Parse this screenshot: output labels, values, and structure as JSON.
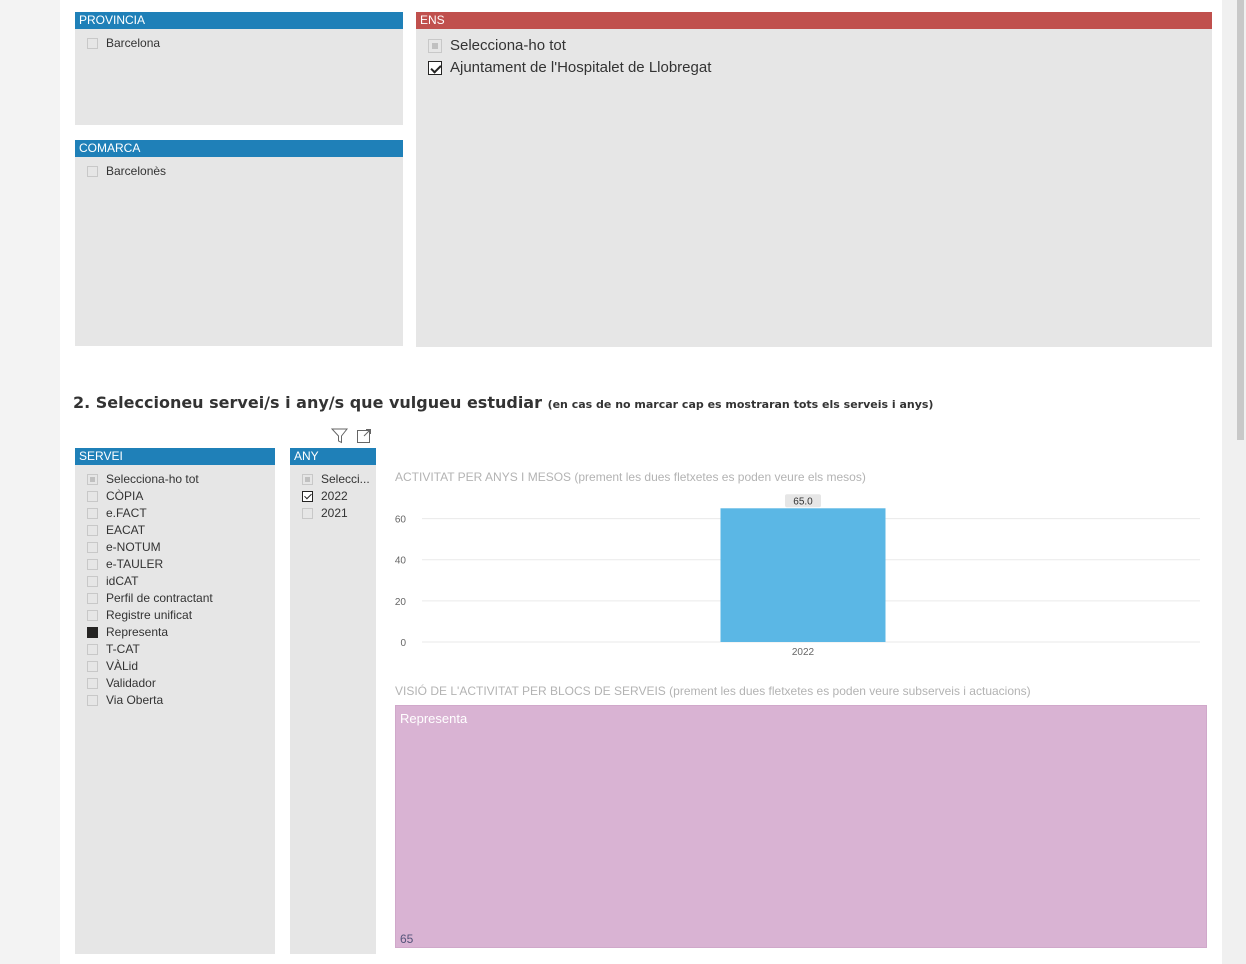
{
  "provincia": {
    "header": "PROVINCIA",
    "items": [
      {
        "label": "Barcelona",
        "state": "unchecked"
      }
    ]
  },
  "comarca": {
    "header": "COMARCA",
    "items": [
      {
        "label": "Barcelonès",
        "state": "unchecked"
      }
    ]
  },
  "ens": {
    "header": "ENS",
    "items": [
      {
        "label": "Selecciona-ho tot",
        "state": "partial"
      },
      {
        "label": "Ajuntament de l'Hospitalet de Llobregat",
        "state": "checked"
      }
    ]
  },
  "section": {
    "title": "2. Seleccioneu servei/s i any/s que vulgueu estudiar",
    "subtitle": "(en cas de no marcar cap es mostraran tots els serveis i anys)"
  },
  "servei": {
    "header": "SERVEI",
    "items": [
      {
        "label": "Selecciona-ho tot",
        "state": "partial"
      },
      {
        "label": "CÒPIA",
        "state": "unchecked"
      },
      {
        "label": "e.FACT",
        "state": "unchecked"
      },
      {
        "label": "EACAT",
        "state": "unchecked"
      },
      {
        "label": "e-NOTUM",
        "state": "unchecked"
      },
      {
        "label": "e-TAULER",
        "state": "unchecked"
      },
      {
        "label": "idCAT",
        "state": "unchecked"
      },
      {
        "label": "Perfil de contractant",
        "state": "unchecked"
      },
      {
        "label": "Registre unificat",
        "state": "unchecked"
      },
      {
        "label": "Representa",
        "state": "filled"
      },
      {
        "label": "T-CAT",
        "state": "unchecked"
      },
      {
        "label": "VÀLid",
        "state": "unchecked"
      },
      {
        "label": "Validador",
        "state": "unchecked"
      },
      {
        "label": "Via Oberta",
        "state": "unchecked"
      }
    ]
  },
  "any": {
    "header": "ANY",
    "icons": [
      "filter-icon",
      "focus-mode-icon"
    ],
    "items": [
      {
        "label": "Selecci...",
        "state": "partial"
      },
      {
        "label": "2022",
        "state": "checked"
      },
      {
        "label": "2021",
        "state": "unchecked"
      }
    ]
  },
  "bar_chart_title": "ACTIVITAT PER ANYS I MESOS (prement les dues fletxetes es poden veure els mesos)",
  "treemap": {
    "title": "VISIÓ DE L'ACTIVITAT PER BLOCS DE SERVEIS (prement les dues fletxetes es poden veure subserveis i actuacions)",
    "label": "Representa",
    "value": "65",
    "color": "#d9b3d3"
  },
  "chart_data": {
    "type": "bar",
    "categories": [
      "2022"
    ],
    "values": [
      65
    ],
    "data_labels": [
      "65.0"
    ],
    "ylim": [
      0,
      70
    ],
    "yticks": [
      0,
      20,
      40,
      60
    ],
    "grid": true,
    "bar_color": "#5bb7e5"
  },
  "colors": {
    "slicer_header": "#1f80b8",
    "ens_header": "#c0504d",
    "slicer_bg": "#e6e6e6"
  }
}
